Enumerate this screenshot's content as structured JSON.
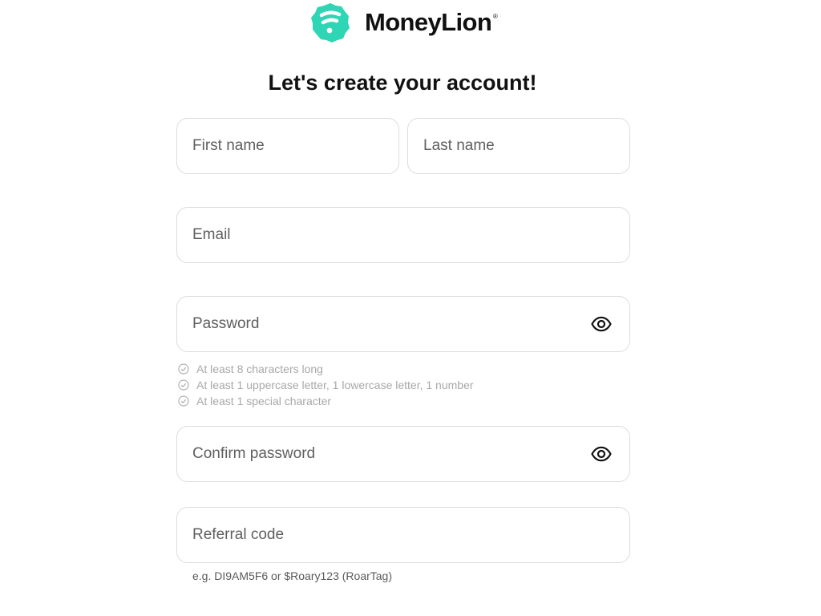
{
  "brand": {
    "name": "MoneyLion",
    "registered_mark": "®",
    "logo_color": "#2fd6b5"
  },
  "form": {
    "heading": "Let's create your account!",
    "first_name": {
      "placeholder": "First name",
      "value": ""
    },
    "last_name": {
      "placeholder": "Last name",
      "value": ""
    },
    "email": {
      "placeholder": "Email",
      "value": ""
    },
    "password": {
      "placeholder": "Password",
      "value": "",
      "toggle_icon": "eye-icon"
    },
    "password_rules": [
      {
        "text": "At least 8 characters long",
        "icon": "check-circle-icon"
      },
      {
        "text": "At least 1 uppercase letter, 1 lowercase letter, 1 number",
        "icon": "check-circle-icon"
      },
      {
        "text": "At least 1 special character",
        "icon": "check-circle-icon"
      }
    ],
    "confirm_password": {
      "placeholder": "Confirm password",
      "value": "",
      "toggle_icon": "eye-icon"
    },
    "referral_code": {
      "placeholder": "Referral code",
      "value": "",
      "hint": "e.g. DI9AM5F6 or $Roary123 (RoarTag)"
    }
  }
}
